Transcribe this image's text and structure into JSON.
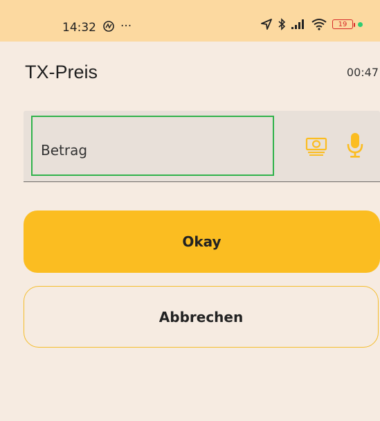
{
  "status_bar": {
    "time": "14:32",
    "more": "···",
    "battery_level": "19",
    "icons": [
      "nfc-icon",
      "location-icon",
      "bluetooth-icon",
      "signal-icon",
      "wifi-icon",
      "battery-icon"
    ]
  },
  "header": {
    "title": "TX-Preis",
    "timer": "00:47"
  },
  "amount_field": {
    "placeholder": "Betrag",
    "value": ""
  },
  "buttons": {
    "okay": "Okay",
    "cancel": "Abbrechen"
  },
  "colors": {
    "accent": "#fbbd21",
    "background": "#f6ebe1",
    "status_bar": "#fcd9a0",
    "focus_outline": "#2fb24a"
  }
}
